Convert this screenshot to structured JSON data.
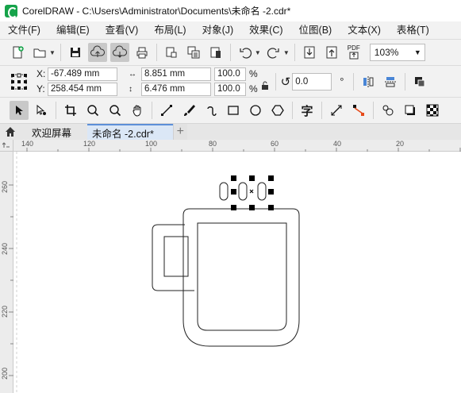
{
  "window": {
    "title": "CorelDRAW - C:\\Users\\Administrator\\Documents\\未命名 -2.cdr*"
  },
  "menu": [
    {
      "label": "文件(F)"
    },
    {
      "label": "编辑(E)"
    },
    {
      "label": "查看(V)"
    },
    {
      "label": "布局(L)"
    },
    {
      "label": "对象(J)"
    },
    {
      "label": "效果(C)"
    },
    {
      "label": "位图(B)"
    },
    {
      "label": "文本(X)"
    },
    {
      "label": "表格(T)"
    }
  ],
  "standard_toolbar": {
    "zoom_value": "103%",
    "export_pdf_label": "PDF",
    "icons": [
      "new-document-icon",
      "open-folder-icon",
      "save-icon",
      "cloud-upload-icon",
      "cloud-download-icon",
      "print-icon",
      "cut-icon",
      "copy-icon",
      "paste-icon",
      "undo-icon",
      "redo-icon",
      "import-icon",
      "export-icon",
      "export-pdf-icon"
    ]
  },
  "property_bar": {
    "x_label": "X:",
    "y_label": "Y:",
    "x_value": "-67.489 mm",
    "y_value": "258.454 mm",
    "width_value": "8.851 mm",
    "height_value": "6.476 mm",
    "scale_x": "100.0",
    "scale_y": "100.0",
    "percent": "%",
    "rotation_value": "0.0",
    "degree_symbol": "°"
  },
  "toolbox": {
    "text_tool_glyph": "字",
    "icons": [
      "pick-tool-icon",
      "shape-tool-icon",
      "crop-tool-icon",
      "zoom-tool-icon",
      "zoom-out-icon",
      "pan-tool-icon",
      "freehand-tool-icon",
      "artistic-media-icon",
      "spiral-icon",
      "rectangle-tool-icon",
      "ellipse-tool-icon",
      "polygon-tool-icon",
      "text-tool-icon",
      "parallel-dimension-icon",
      "connector-tool-icon",
      "blend-tool-icon",
      "drop-shadow-icon",
      "transparency-icon"
    ]
  },
  "tabs": [
    {
      "label": "欢迎屏幕"
    },
    {
      "label": "未命名 -2.cdr*"
    }
  ],
  "rulers": {
    "horizontal": [
      "140",
      "120",
      "100",
      "80",
      "60",
      "40",
      "20"
    ],
    "vertical": [
      "260",
      "240",
      "220",
      "200"
    ]
  },
  "colors": {
    "accent": "#5d8fd8",
    "logo": "#16a34a",
    "selection_handle": "#000000"
  }
}
